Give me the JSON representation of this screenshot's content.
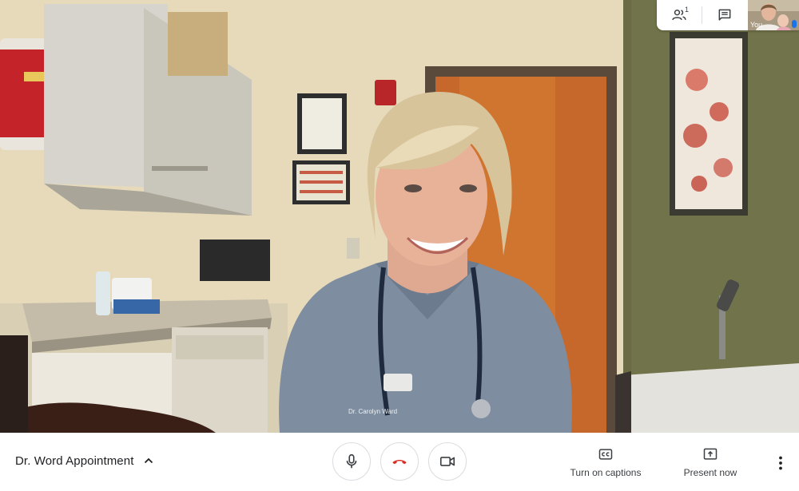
{
  "meeting": {
    "title": "Dr. Word Appointment"
  },
  "top_panel": {
    "participants_count": "1",
    "self_tile_label": "You"
  },
  "video": {
    "badge_text": "Dr. Carolyn Ward"
  },
  "controls": {
    "captions_label": "Turn on captions",
    "present_label": "Present now"
  },
  "icons": {
    "participants": "people-icon",
    "chat": "chat-icon",
    "caret": "chevron-up-icon",
    "mic": "microphone-icon",
    "end": "hang-up-icon",
    "camera": "camera-icon",
    "captions": "closed-captions-icon",
    "present": "present-screen-icon",
    "more": "more-vertical-icon"
  },
  "colors": {
    "end_call_red": "#d93025",
    "icon_gray": "#3c4043",
    "active_blue": "#1a73e8"
  }
}
